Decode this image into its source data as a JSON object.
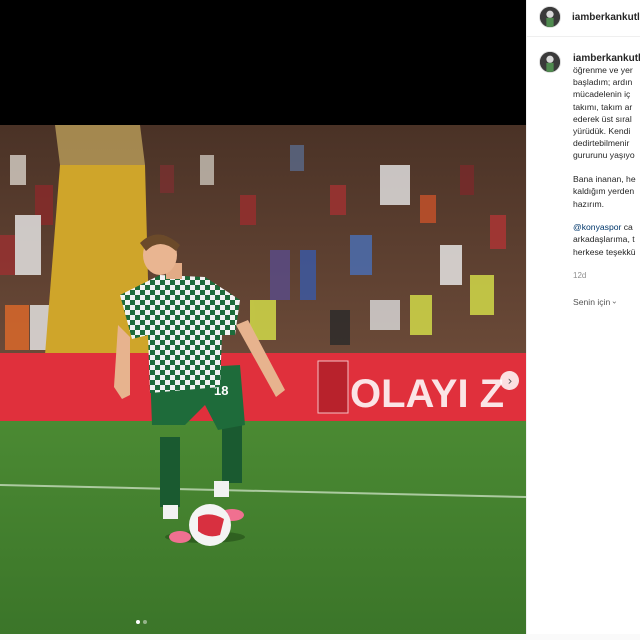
{
  "post": {
    "username": "iamberkankutlu",
    "caption": {
      "author": "iamberkankutlu",
      "lines": [
        "öğrenme ve yer",
        "başladım; ardın",
        "mücadelenin iç",
        "takımı, takım ar",
        "ederek üst sıral",
        "yürüdük. Kendi",
        "dedirtebilmenir",
        "gururunu yaşıyo"
      ],
      "lines2": [
        "Bana inanan, he",
        "kaldığım yerden",
        "hazırım."
      ],
      "mention": "@konyaspor",
      "mention_rest": " ca",
      "lines3": [
        "arkadaşlarıma, t",
        "herkese teşekkü"
      ]
    },
    "time": "12d",
    "audience": "Senin için",
    "banner_text": "OLAYI Z",
    "jersey_number": "18"
  },
  "icons": {
    "next": "chevron-right-icon",
    "audience": "chevron-down-icon"
  },
  "colors": {
    "pitch": "#3c7a2c",
    "board": "#e0303c",
    "kit": "#1e6b3a"
  }
}
